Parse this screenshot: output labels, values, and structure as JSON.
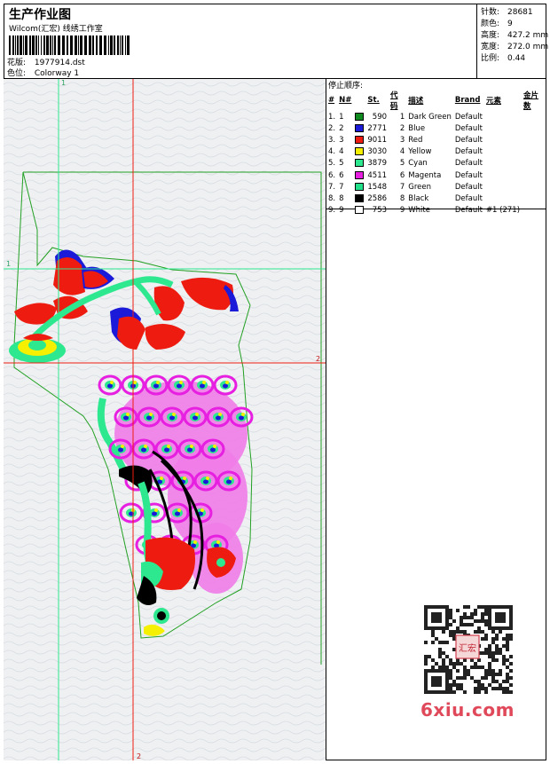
{
  "header": {
    "title": "生产作业图",
    "company": "Wilcom(汇宏) 线绣工作室",
    "file_label": "花版:",
    "file_value": "1977914.dst",
    "colorway_label": "色位:",
    "colorway_value": "Colorway 1"
  },
  "stats": {
    "stitches_label": "针数:",
    "stitches_value": "28681",
    "colors_label": "颜色:",
    "colors_value": "9",
    "height_label": "高度:",
    "height_value": "427.2 mm",
    "width_label": "宽度:",
    "width_value": "272.0 mm",
    "scale_label": "比例:",
    "scale_value": "0.44"
  },
  "stop_list": {
    "title": "停止顺序:",
    "headers": [
      "#",
      "N#",
      "St.",
      "代码",
      "描述",
      "Brand",
      "元素",
      "金片数"
    ],
    "rows": [
      {
        "idx": "1.",
        "n": "1",
        "color": "#0f8a1f",
        "st": "590",
        "code": "1",
        "desc": "Dark Green",
        "brand": "Default",
        "elem": ""
      },
      {
        "idx": "2.",
        "n": "2",
        "color": "#1a1ad8",
        "st": "2771",
        "code": "2",
        "desc": "Blue",
        "brand": "Default",
        "elem": ""
      },
      {
        "idx": "3.",
        "n": "3",
        "color": "#ee1c10",
        "st": "9011",
        "code": "3",
        "desc": "Red",
        "brand": "Default",
        "elem": ""
      },
      {
        "idx": "4.",
        "n": "4",
        "color": "#f4f000",
        "st": "3030",
        "code": "4",
        "desc": "Yellow",
        "brand": "Default",
        "elem": ""
      },
      {
        "idx": "5.",
        "n": "5",
        "color": "#2ee890",
        "st": "3879",
        "code": "5",
        "desc": "Cyan",
        "brand": "Default",
        "elem": ""
      },
      {
        "idx": "6.",
        "n": "6",
        "color": "#e61fe0",
        "st": "4511",
        "code": "6",
        "desc": "Magenta",
        "brand": "Default",
        "elem": ""
      },
      {
        "idx": "7.",
        "n": "7",
        "color": "#22e08a",
        "st": "1548",
        "code": "7",
        "desc": "Green",
        "brand": "Default",
        "elem": ""
      },
      {
        "idx": "8.",
        "n": "8",
        "color": "#000000",
        "st": "2586",
        "code": "8",
        "desc": "Black",
        "brand": "Default",
        "elem": ""
      },
      {
        "idx": "9.",
        "n": "9",
        "color": "#ffffff",
        "st": "753",
        "code": "9",
        "desc": "White",
        "brand": "Default",
        "elem": "#1 (271)"
      }
    ]
  },
  "guides": {
    "v1_label": "1",
    "h1_label": "1",
    "h2_label": "2",
    "v2_label": "2"
  },
  "watermark": "6xiu.com",
  "qr_stamp_text": "汇宏"
}
